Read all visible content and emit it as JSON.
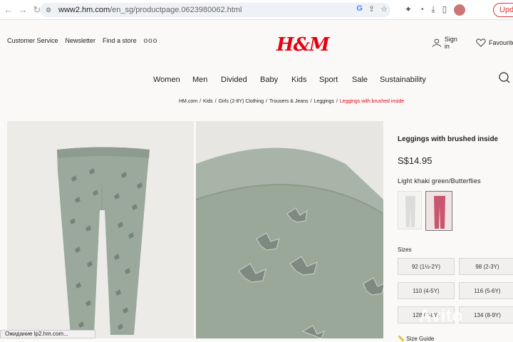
{
  "browser": {
    "url_domain": "www2.hm.com",
    "url_path": "/en_sg/productpage.0623980062.html",
    "update_label": "Update",
    "status_text": "Ожидание lp2.hm.com..."
  },
  "header": {
    "util_left": [
      "Customer Service",
      "Newsletter",
      "Find a store"
    ],
    "more_label": "ooo",
    "logo": "H&M",
    "sign_in": "Sign in",
    "favourites": "Favourites"
  },
  "nav": {
    "items": [
      "Women",
      "Men",
      "Divided",
      "Baby",
      "Kids",
      "Sport",
      "Sale",
      "Sustainability"
    ]
  },
  "breadcrumb": {
    "items": [
      "HM.com",
      "Kids",
      "Girls (2-8Y) Clothing",
      "Trousers & Jeans",
      "Leggings"
    ],
    "current": "Leggings with brushed inside",
    "separator": "/"
  },
  "product": {
    "title": "Leggings with brushed inside",
    "price": "S$14.95",
    "color_name": "Light khaki green/Butterflies",
    "sizes_label": "Sizes",
    "sizes": [
      "92 (1½-2Y)",
      "98 (2-3Y)",
      "110 (4-5Y)",
      "116 (5-6Y)",
      "128 (7-8Y)",
      "134 (8-9Y)"
    ],
    "size_guide": "Size Guide"
  },
  "watermark": "Avito",
  "colors": {
    "brand": "#e50010",
    "legging_green": "#9aa99b"
  }
}
